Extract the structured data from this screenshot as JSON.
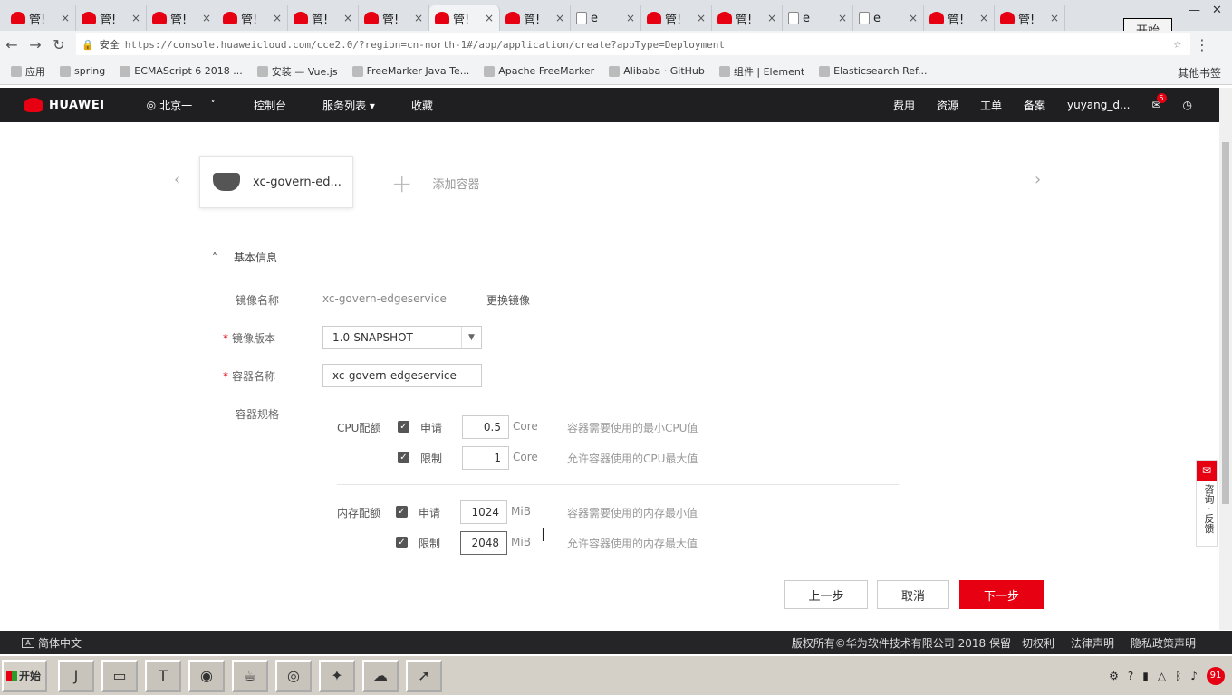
{
  "browser": {
    "tabs": [
      {
        "label": "管!",
        "active": false
      },
      {
        "label": "管!",
        "active": false
      },
      {
        "label": "管!",
        "active": false
      },
      {
        "label": "管!",
        "active": false
      },
      {
        "label": "管!",
        "active": false
      },
      {
        "label": "管!",
        "active": false
      },
      {
        "label": "管!",
        "active": true
      },
      {
        "label": "管!",
        "active": false
      },
      {
        "label": "e",
        "active": false
      },
      {
        "label": "管!",
        "active": false
      },
      {
        "label": "管!",
        "active": false
      },
      {
        "label": "e",
        "active": false
      },
      {
        "label": "e",
        "active": false
      },
      {
        "label": "管!",
        "active": false
      },
      {
        "label": "管!",
        "active": false
      }
    ],
    "start_tooltip": "开始",
    "security_label": "安全",
    "url": "https://console.huaweicloud.com/cce2.0/?region=cn-north-1#/app/application/create?appType=Deployment",
    "bookmarks": [
      "应用",
      "spring",
      "ECMAScript 6 2018 ...",
      "安装 — Vue.js",
      "FreeMarker Java Te...",
      "Apache FreeMarker",
      "Alibaba · GitHub",
      "组件 | Element",
      "Elasticsearch Ref..."
    ],
    "bookmarks_more": "其他书签"
  },
  "header": {
    "brand": "HUAWEI",
    "region": "北京一",
    "menu": [
      "控制台",
      "服务列表 ▾",
      "收藏"
    ],
    "right": [
      "费用",
      "资源",
      "工单",
      "备案",
      "yuyang_d..."
    ],
    "notification_count": "5"
  },
  "containers": {
    "current": "xc-govern-ed...",
    "add_label": "添加容器"
  },
  "section": {
    "title": "基本信息",
    "image_name_label": "镜像名称",
    "image_name_value": "xc-govern-edgeservice",
    "change_image": "更换镜像",
    "image_version_label": "镜像版本",
    "image_version_value": "1.0-SNAPSHOT",
    "container_name_label": "容器名称",
    "container_name_value": "xc-govern-edgeservice",
    "spec_label": "容器规格"
  },
  "cpu": {
    "label": "CPU配额",
    "request_label": "申请",
    "request_value": "0.5",
    "limit_label": "限制",
    "limit_value": "1",
    "unit": "Core",
    "request_hint": "容器需要使用的最小CPU值",
    "limit_hint": "允许容器使用的CPU最大值"
  },
  "memory": {
    "label": "内存配额",
    "request_label": "申请",
    "request_value": "1024",
    "limit_label": "限制",
    "limit_value": "2048",
    "unit": "MiB",
    "request_hint": "容器需要使用的内存最小值",
    "limit_hint": "允许容器使用的内存最大值"
  },
  "feedback": "咨询 · 反馈",
  "buttons": {
    "prev": "上一步",
    "cancel": "取消",
    "next": "下一步"
  },
  "footer": {
    "language": "简体中文",
    "copyright": "版权所有©华为软件技术有限公司 2018 保留一切权利",
    "legal": "法律声明",
    "privacy": "隐私政策声明"
  },
  "taskbar": {
    "start": "开始",
    "clock_badge": "91"
  },
  "colors": {
    "brand": "#e60012",
    "header_bg": "#1f1f22"
  }
}
